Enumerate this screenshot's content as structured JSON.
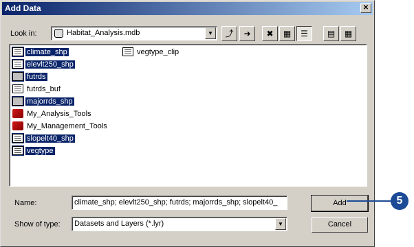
{
  "window": {
    "title": "Add Data",
    "close_glyph": "✕"
  },
  "lookin": {
    "label": "Look in:",
    "value": "Habitat_Analysis.mdb",
    "icon": "database-icon"
  },
  "toolbar": [
    {
      "name": "up-one-level-button",
      "icon": "up-folder-icon",
      "glyph": "⤴"
    },
    {
      "name": "connect-folder-button",
      "icon": "connect-folder-icon",
      "glyph": "➜"
    },
    {
      "name": "disconnect-folder-button",
      "icon": "disconnect-folder-icon",
      "glyph": "✖"
    },
    {
      "name": "catalog-button",
      "icon": "catalog-icon",
      "glyph": "▦"
    },
    {
      "name": "list-view-button",
      "icon": "list-icon",
      "glyph": "☰"
    },
    {
      "name": "details-view-button",
      "icon": "details-icon",
      "glyph": "▤"
    },
    {
      "name": "thumbnails-view-button",
      "icon": "thumbnails-icon",
      "glyph": "▦"
    }
  ],
  "files": {
    "col1": [
      {
        "label": "climate_shp",
        "icon": "table",
        "selected": true
      },
      {
        "label": "elevlt250_shp",
        "icon": "table",
        "selected": true
      },
      {
        "label": "futrds",
        "icon": "folder",
        "selected": true
      },
      {
        "label": "futrds_buf",
        "icon": "table",
        "selected": false
      },
      {
        "label": "majorrds_shp",
        "icon": "folder",
        "selected": true
      },
      {
        "label": "My_Analysis_Tools",
        "icon": "toolbox",
        "selected": false
      },
      {
        "label": "My_Management_Tools",
        "icon": "toolbox",
        "selected": false
      },
      {
        "label": "slopelt40_shp",
        "icon": "table",
        "selected": true
      },
      {
        "label": "vegtype",
        "icon": "table",
        "selected": true
      }
    ],
    "col2": [
      {
        "label": "vegtype_clip",
        "icon": "table",
        "selected": false
      }
    ]
  },
  "name_field": {
    "label": "Name:",
    "value": "climate_shp; elevlt250_shp; futrds; majorrds_shp; slopelt40_"
  },
  "type_field": {
    "label": "Show of type:",
    "value": "Datasets and Layers (*.lyr)"
  },
  "buttons": {
    "add": "Add",
    "cancel": "Cancel"
  },
  "callout": {
    "number": "5"
  },
  "colors": {
    "selection": "#0a246a",
    "callout": "#1c4a96",
    "dialog": "#d4d0c8"
  }
}
